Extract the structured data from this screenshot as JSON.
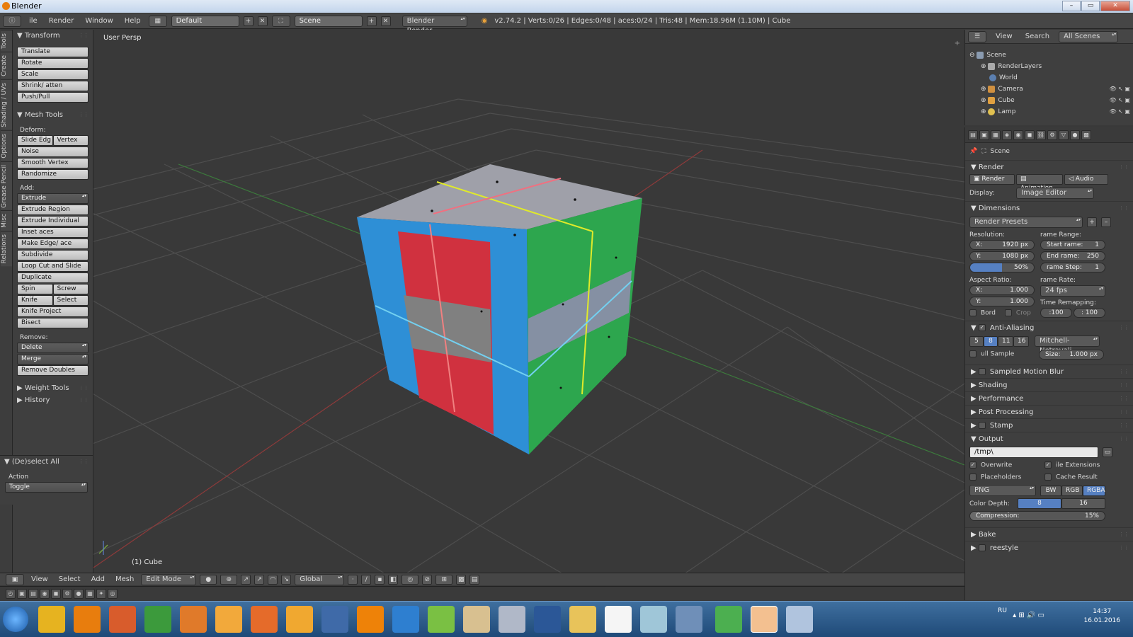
{
  "window": {
    "title": "Blender"
  },
  "infobar": {
    "menus": [
      "ile",
      "Render",
      "Window",
      "Help"
    ],
    "layout": "Default",
    "scene": "Scene",
    "engine": "Blender Render",
    "stats": "v2.74.2 | Verts:0/26 | Edges:0/48 | aces:0/24 | Tris:48 | Mem:18.96M (1.10M) | Cube"
  },
  "lefttabs": [
    "Tools",
    "Create",
    "Shading / UVs",
    "Options",
    "Grease Pencil",
    "Misc",
    "Relations"
  ],
  "toolshelf": {
    "transform": {
      "title": "Transform",
      "items": [
        "Translate",
        "Rotate",
        "Scale",
        "Shrink/ atten",
        "Push/Pull"
      ]
    },
    "meshtools": {
      "title": "Mesh Tools",
      "deform_label": "Deform:",
      "slide_edge": "Slide Edg",
      "vertex": "Vertex",
      "noise": "Noise",
      "smooth_vertex": "Smooth Vertex",
      "randomize": "Randomize",
      "add_label": "Add:",
      "extrude": "Extrude",
      "extrude_region": "Extrude Region",
      "extrude_individual": "Extrude Individual",
      "inset": "Inset  aces",
      "make_edge": "Make Edge/  ace",
      "subdivide": "Subdivide",
      "loopcut": "Loop Cut and Slide",
      "duplicate": "Duplicate",
      "spin": "Spin",
      "screw": "Screw",
      "knife": "Knife",
      "select": "Select",
      "knife_project": "Knife Project",
      "bisect": "Bisect",
      "remove_label": "Remove:",
      "delete": "Delete",
      "merge": "Merge",
      "remove_doubles": "Remove Doubles"
    },
    "weight_tools": "Weight Tools",
    "history": "History",
    "deselect": {
      "title": "(De)select All",
      "action_label": "Action",
      "toggle": "Toggle"
    }
  },
  "viewport": {
    "persp": "User Persp",
    "object": "(1) Cube"
  },
  "viewheader": {
    "menus": [
      "View",
      "Select",
      "Add",
      "Mesh"
    ],
    "mode": "Edit Mode",
    "orientation": "Global"
  },
  "outliner": {
    "menus": [
      "View",
      "Search"
    ],
    "filter": "All Scenes",
    "tree": [
      "Scene",
      "RenderLayers",
      "World",
      "Camera",
      "Cube",
      "Lamp"
    ]
  },
  "properties": {
    "scene": "Scene",
    "render": {
      "title": "Render",
      "render_btn": "Render",
      "animation_btn": "Animation",
      "audio_btn": "Audio",
      "display_label": "Display:",
      "display": "Image Editor"
    },
    "dimensions": {
      "title": "Dimensions",
      "presets": "Render Presets",
      "res_label": "Resolution:",
      "res_x": "X:",
      "res_x_val": "1920 px",
      "res_y": "Y:",
      "res_y_val": "1080 px",
      "res_pct": "50%",
      "frame_range_label": "rame Range:",
      "start": "Start  rame:",
      "start_val": "1",
      "end": "End  rame:",
      "end_val": "250",
      "step": "rame Step:",
      "step_val": "1",
      "aspect_label": "Aspect Ratio:",
      "asp_x": "X:",
      "asp_x_val": "1.000",
      "asp_y": "Y:",
      "asp_y_val": "1.000",
      "frame_rate_label": "rame Rate:",
      "fps": "24 fps",
      "time_remap": "Time Remapping:",
      "old": ":100",
      "new": ": 100",
      "bord": "Bord",
      "crop": "Crop"
    },
    "aa": {
      "title": "Anti-Aliasing",
      "samples": [
        "5",
        "8",
        "11",
        "16"
      ],
      "filter": "Mitchell-Netravali",
      "full_sample": "ull Sample",
      "size": "Size:",
      "size_val": "1.000 px"
    },
    "sections": [
      "Sampled Motion Blur",
      "Shading",
      "Performance",
      "Post Processing",
      "Stamp"
    ],
    "output": {
      "title": "Output",
      "path": "/tmp\\",
      "overwrite": "Overwrite",
      "file_ext": "ile Extensions",
      "placeholders": "Placeholders",
      "cache": "Cache Result",
      "format": "PNG",
      "bw": "BW",
      "rgb": "RGB",
      "rgba": "RGBA",
      "depth_label": "Color Depth:",
      "depth8": "8",
      "depth16": "16",
      "compression": "Compression:",
      "compression_val": "15%"
    },
    "bake": "Bake",
    "freestyle": "reestyle"
  },
  "taskbar": {
    "lang": "RU",
    "time": "14:37",
    "date": "16.01.2016"
  }
}
